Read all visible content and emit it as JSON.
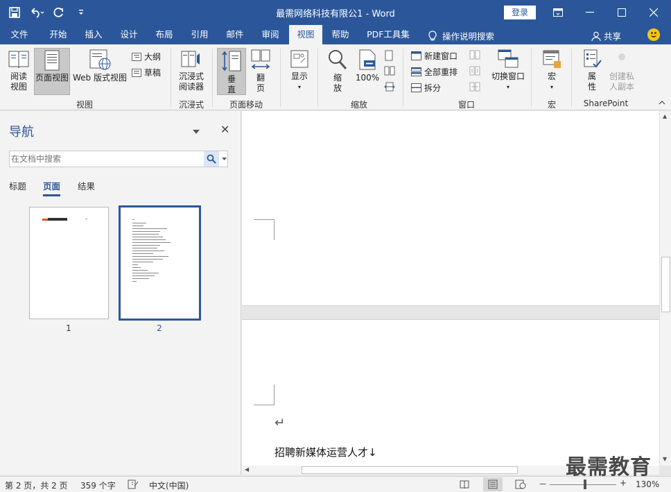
{
  "titlebar": {
    "title": "最需网络科技有限公1  -  Word",
    "login": "登录"
  },
  "tabs": [
    {
      "label": "文件"
    },
    {
      "label": "开始"
    },
    {
      "label": "插入"
    },
    {
      "label": "设计"
    },
    {
      "label": "布局"
    },
    {
      "label": "引用"
    },
    {
      "label": "邮件"
    },
    {
      "label": "审阅"
    },
    {
      "label": "视图"
    },
    {
      "label": "帮助"
    },
    {
      "label": "PDF工具集"
    }
  ],
  "tell_me": "操作说明搜索",
  "share": "共享",
  "ribbon": {
    "views": {
      "read_mode": [
        "阅读",
        "视图"
      ],
      "print_layout": "页面视图",
      "web_layout": "Web 版式视图",
      "outline": "大纲",
      "draft": "草稿",
      "label": "视图"
    },
    "immersive": {
      "reader": [
        "沉浸式",
        "阅读器"
      ],
      "label": "沉浸式"
    },
    "page_move": {
      "vertical": [
        "垂",
        "直"
      ],
      "side_to_side": [
        "翻",
        "页"
      ],
      "label": "页面移动"
    },
    "show": {
      "label": "显示"
    },
    "zoom": {
      "zoom": [
        "缩",
        "放"
      ],
      "hundred": "100%",
      "label": "缩放"
    },
    "window": {
      "new_window": "新建窗口",
      "arrange_all": "全部重排",
      "split": "拆分",
      "switch": "切换窗口",
      "label": "窗口"
    },
    "macros": {
      "macros": "宏",
      "label": "宏"
    },
    "sharepoint": {
      "properties": [
        "属",
        "性"
      ],
      "private_copy": [
        "创建私",
        "人副本"
      ],
      "label": "SharePoint"
    }
  },
  "nav": {
    "title": "导航",
    "search_placeholder": "在文档中搜索",
    "tabs": [
      "标题",
      "页面",
      "结果"
    ],
    "pages": [
      "1",
      "2"
    ]
  },
  "document": {
    "paragraph_mark": "↵",
    "text": "招聘新媒体运营人才↓"
  },
  "watermark": "最需教育",
  "status": {
    "page": "第 2 页，共 2 页",
    "words": "359 个字",
    "language": "中文(中国)",
    "zoom": "130%",
    "zoom_minus": "－",
    "zoom_plus": "+"
  }
}
